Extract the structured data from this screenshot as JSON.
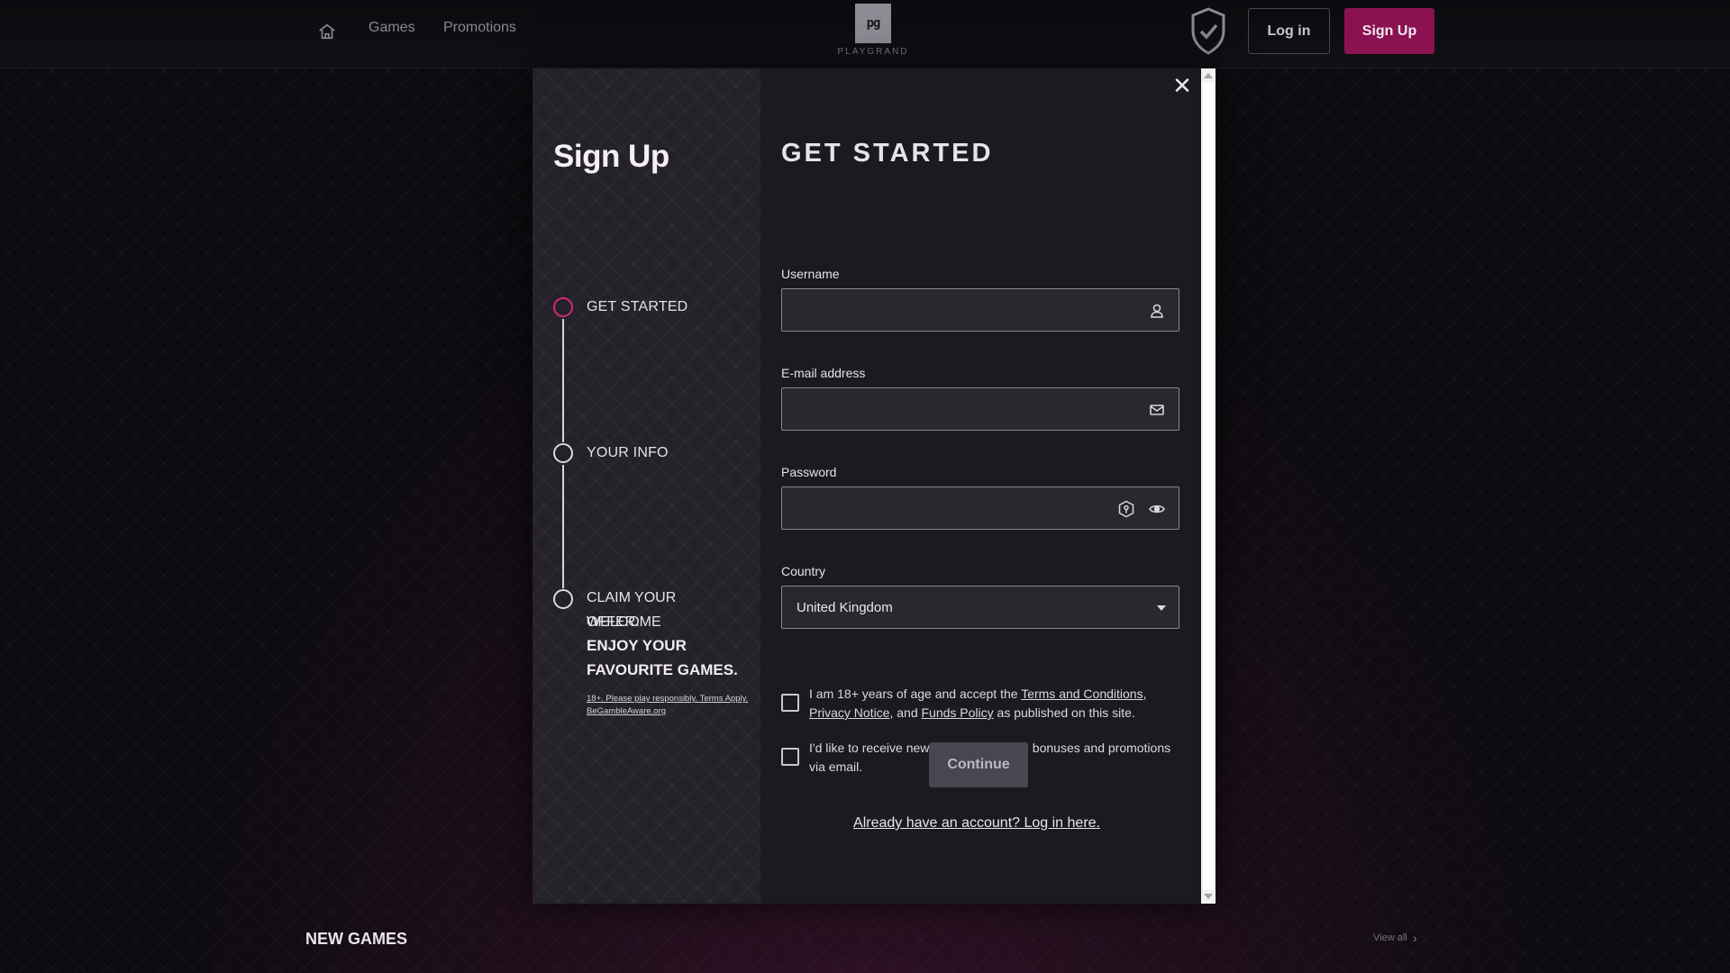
{
  "nav": {
    "home_icon": "home-icon",
    "links": [
      "Games",
      "Promotions"
    ],
    "logo_mark": "pg",
    "logo_text": "PLAYGRAND",
    "shield_icon": "shield-check-icon",
    "login_label": "Log in",
    "signup_label": "Sign Up"
  },
  "modal": {
    "close_icon": "close-icon",
    "left": {
      "title": "Sign Up",
      "steps": [
        "GET STARTED",
        "YOUR INFO",
        "CLAIM YOUR WELCOME"
      ],
      "offer_line2": "OFFER.",
      "offer_bold1": "ENJOY YOUR",
      "offer_bold2": "FAVOURITE GAMES.",
      "disclaimer": "18+. Please play responsibly. Terms Apply. BeGambleAware.org"
    },
    "form": {
      "title": "GET STARTED",
      "username_label": "Username",
      "email_label": "E-mail address",
      "password_label": "Password",
      "country_label": "Country",
      "country_value": "United Kingdom",
      "terms_text_1": "I am 18+ years of age and accept the ",
      "terms_link_1": "Terms and Conditions",
      "terms_text_2": ", ",
      "terms_link_2": "Privacy Notice",
      "terms_text_3": ", and ",
      "terms_link_3": "Funds Policy",
      "terms_text_4": " as published on this site.",
      "news_text": "I'd like to receive news about upcoming bonuses and promotions via email.",
      "continue_label": "Continue",
      "login_link": "Already have an account? Log in here."
    },
    "accent_color": "#d6287a"
  },
  "bottom": {
    "section_title": "NEW GAMES",
    "view_all": "View all"
  }
}
